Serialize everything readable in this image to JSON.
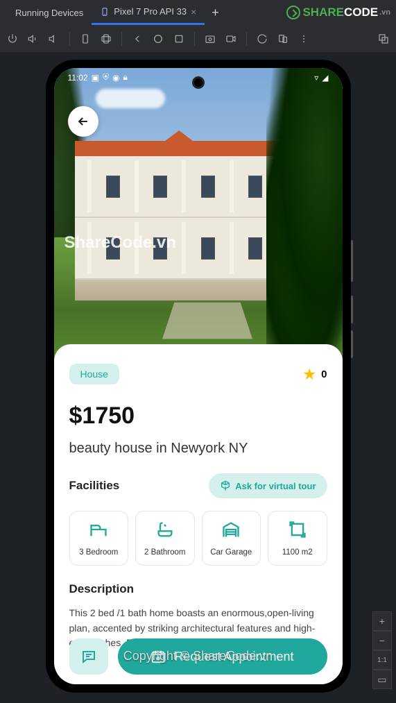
{
  "ide": {
    "panel_title": "Running Devices",
    "tab_label": "Pixel 7 Pro API 33",
    "logo_text1": "SHARE",
    "logo_text2": "CODE",
    "logo_suffix": ".vn"
  },
  "statusbar": {
    "time": "11:02"
  },
  "watermark": "ShareCode.vn",
  "listing": {
    "category": "House",
    "rating": "0",
    "price": "$1750",
    "title": "beauty house in Newyork NY",
    "facilities_heading": "Facilities",
    "virtual_tour_label": "Ask for virtual tour",
    "facilities": [
      {
        "label": "3 Bedroom"
      },
      {
        "label": "2 Bathroom"
      },
      {
        "label": "Car Garage"
      },
      {
        "label": "1100 m2"
      }
    ],
    "description_heading": "Description",
    "description_text": "This 2 bed /1 bath home boasts an enormous,open-living plan, accented by striking architectural features and high-end finishes. Feel inspired by open sight lines that"
  },
  "actions": {
    "cta_label": "Request Appointment"
  },
  "copyright": "Copyright © ShareCode.vn",
  "zoom": {
    "ratio": "1:1"
  }
}
